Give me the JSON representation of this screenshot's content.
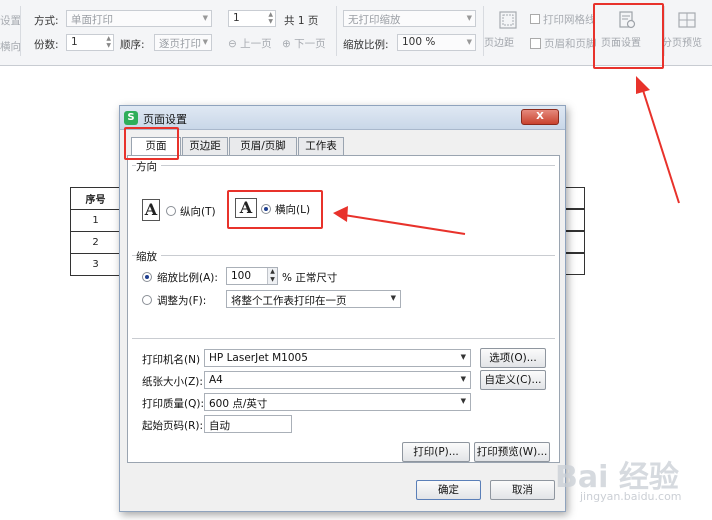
{
  "toolbar": {
    "cut_left_top": "设置",
    "cut_left_bottom": "横向",
    "mode_label": "方式:",
    "mode_value": "单面打印",
    "copies_label": "份数:",
    "copies_value": "1",
    "order_label": "顺序:",
    "order_value": "逐页打印",
    "page_value": "1",
    "page_total": "共 1 页",
    "prev_page": "上一页",
    "next_page": "下一页",
    "scale_mode_value": "无打印缩放",
    "zoom_label": "缩放比例:",
    "zoom_value": "100 %",
    "margins_label": "页边距",
    "print_gridlines_label": "打印网格线",
    "header_footer_label": "页眉和页脚",
    "page_setup_label": "页面设置",
    "split_preview_label": "分页预览"
  },
  "sheet": {
    "header": "序号",
    "rows": [
      "1",
      "2",
      "3"
    ]
  },
  "dialog": {
    "logo": "S",
    "title": "页面设置",
    "close_label": "X",
    "tabs": [
      "页面",
      "页边距",
      "页眉/页脚",
      "工作表"
    ],
    "orientation": {
      "group_label": "方向",
      "portrait_icon": "A",
      "portrait_label": "纵向(T)",
      "landscape_icon": "A",
      "landscape_label": "横向(L)",
      "selected": "landscape"
    },
    "scaling": {
      "group_label": "缩放",
      "scale_label": "缩放比例(A):",
      "scale_value": "100",
      "scale_suffix": "% 正常尺寸",
      "fit_label": "调整为(F):",
      "fit_value": "将整个工作表打印在一页"
    },
    "printer_label": "打印机名(N)",
    "printer_value": "HP LaserJet M1005",
    "options_button": "选项(O)...",
    "paper_label": "纸张大小(Z):",
    "paper_value": "A4",
    "custom_button": "自定义(C)...",
    "quality_label": "打印质量(Q):",
    "quality_value": "600 点/英寸",
    "first_page_label": "起始页码(R):",
    "first_page_value": "自动",
    "print_button": "打印(P)...",
    "preview_button": "打印预览(W)...",
    "ok_button": "确定",
    "cancel_button": "取消"
  },
  "watermark": {
    "text": "Bai 经验",
    "url": "jingyan.baidu.com"
  },
  "colors": {
    "annotation_red": "#e8322b",
    "selected_radio": "#1f3f8f",
    "wps_green": "#2fae5a"
  }
}
